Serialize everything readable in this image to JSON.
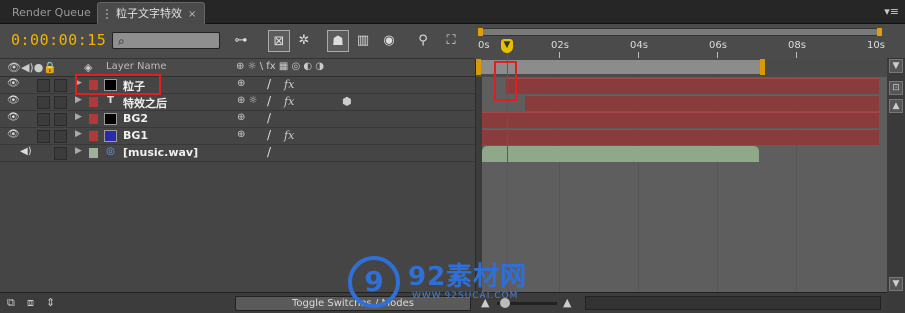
{
  "tabs": [
    {
      "label": "Render Queue",
      "active": false
    },
    {
      "label": "粒子文字特效",
      "active": true
    }
  ],
  "tab_close": "×",
  "panel_menu": "▾≡",
  "timecode": "0:00:00:15",
  "search": {
    "placeholder": "",
    "icon": "search-icon"
  },
  "ruler": {
    "labels": [
      "0s",
      "02s",
      "04s",
      "06s",
      "08s",
      "10s"
    ],
    "playhead_marker": "▼"
  },
  "columns": {
    "layer_name": "Layer Name",
    "switches": "⊕ ☼ \\ fx ▦ ◎ ◐ ◑"
  },
  "layers": [
    {
      "name": "粒子",
      "label_color": "#b03a3a",
      "source_color": "#000000",
      "type": "solid",
      "fx": true,
      "three_d": false
    },
    {
      "name": "特效之后",
      "label_color": "#b03a3a",
      "source_color": "",
      "type": "text",
      "source_glyph": "T",
      "fx": true,
      "three_d": true
    },
    {
      "name": "BG2",
      "label_color": "#b03a3a",
      "source_color": "#000000",
      "type": "solid",
      "fx": false,
      "three_d": false
    },
    {
      "name": "BG1",
      "label_color": "#b03a3a",
      "source_color": "#2a2ab0",
      "type": "solid",
      "fx": true,
      "three_d": false
    },
    {
      "name": "[music.wav]",
      "label_color": "#9bb39a",
      "source_color": "",
      "type": "audio",
      "source_glyph": "◎",
      "fx": false,
      "three_d": false
    }
  ],
  "bottom": {
    "toggle_label": "Toggle Switches / Modes"
  },
  "watermark": {
    "logo_glyph": "9",
    "text": "92素材网",
    "url": "WWW.92SUCAI.COM"
  },
  "colors": {
    "accent_timecode": "#f0b400",
    "layer_bar": "#8a3b3b",
    "audio_bar": "#8fa88a",
    "highlight": "#e02020"
  }
}
